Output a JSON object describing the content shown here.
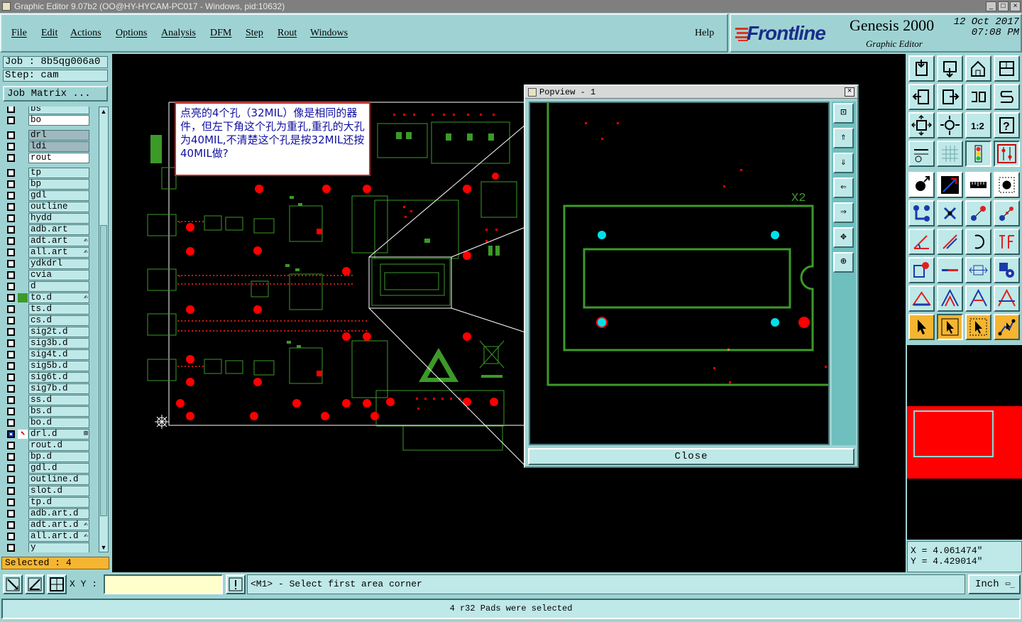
{
  "window": {
    "title": "Graphic Editor 9.07b2 (OO@HY-HYCAM-PC017 - Windows, pid:10632)",
    "controls": [
      "_",
      "□",
      "×"
    ]
  },
  "menu": {
    "items": [
      "File",
      "Edit",
      "Actions",
      "Options",
      "Analysis",
      "DFM",
      "Step",
      "Rout",
      "Windows"
    ],
    "help": "Help"
  },
  "brand": {
    "logo": "Frontline",
    "product": "Genesis 2000",
    "subtitle": "Graphic Editor",
    "date": "12 Oct 2017",
    "time": "07:08 PM"
  },
  "job": {
    "job_label": "Job : 8b5qg006a0",
    "step_label": "Step: cam",
    "matrix_button": "Job Matrix ..."
  },
  "layers": [
    {
      "name": "bs",
      "style": "normal"
    },
    {
      "name": "bo",
      "style": "white"
    },
    {
      "name": "drl",
      "style": "grey",
      "group_gap": true
    },
    {
      "name": "ldi",
      "style": "grey"
    },
    {
      "name": "rout",
      "style": "white"
    },
    {
      "name": "tp",
      "style": "normal",
      "group_gap": true
    },
    {
      "name": "bp",
      "style": "normal"
    },
    {
      "name": "gdl",
      "style": "normal"
    },
    {
      "name": "outline",
      "style": "normal"
    },
    {
      "name": "hydd",
      "style": "normal"
    },
    {
      "name": "adb.art",
      "style": "normal"
    },
    {
      "name": "adt.art",
      "style": "normal",
      "pen": "✍"
    },
    {
      "name": "all.art",
      "style": "normal",
      "pen": "✍"
    },
    {
      "name": "ydkdrl",
      "style": "normal"
    },
    {
      "name": "cvia",
      "style": "normal"
    },
    {
      "name": "d",
      "style": "normal"
    },
    {
      "name": "to.d",
      "style": "normal",
      "mark": "green",
      "pen": "✍"
    },
    {
      "name": "ts.d",
      "style": "normal"
    },
    {
      "name": "cs.d",
      "style": "normal"
    },
    {
      "name": "sig2t.d",
      "style": "normal"
    },
    {
      "name": "sig3b.d",
      "style": "normal"
    },
    {
      "name": "sig4t.d",
      "style": "normal"
    },
    {
      "name": "sig5b.d",
      "style": "normal"
    },
    {
      "name": "sig6t.d",
      "style": "normal"
    },
    {
      "name": "sig7b.d",
      "style": "normal"
    },
    {
      "name": "ss.d",
      "style": "normal"
    },
    {
      "name": "bs.d",
      "style": "normal"
    },
    {
      "name": "bo.d",
      "style": "normal"
    },
    {
      "name": "drl.d",
      "style": "normal",
      "mark": "red",
      "work": true,
      "pen": "⊞"
    },
    {
      "name": "rout.d",
      "style": "normal"
    },
    {
      "name": "bp.d",
      "style": "normal"
    },
    {
      "name": "gdl.d",
      "style": "normal"
    },
    {
      "name": "outline.d",
      "style": "normal"
    },
    {
      "name": "slot.d",
      "style": "normal"
    },
    {
      "name": "tp.d",
      "style": "normal"
    },
    {
      "name": "adb.art.d",
      "style": "normal"
    },
    {
      "name": "adt.art.d",
      "style": "normal",
      "pen": "✍"
    },
    {
      "name": "all.art.d",
      "style": "normal",
      "pen": "✍"
    },
    {
      "name": "y",
      "style": "normal"
    }
  ],
  "selected_count": "Selected : 4",
  "note": {
    "text": "点亮的4个孔（32MIL）像是相同的器件，但左下角这个孔为重孔,重孔的大孔为40MIL,不清楚这个孔是按32MIL还按40MIL做?"
  },
  "popview": {
    "title": "Popview - 1",
    "close_label": "Close",
    "component_label": "X2"
  },
  "coords": {
    "x": "X = 4.061474\"",
    "y": "Y = 4.429014\""
  },
  "bottom": {
    "xy_label": "X Y :",
    "xy_value": "",
    "prompt": "<M1> - Select first area corner",
    "unit": "Inch",
    "status": "4 r32 Pads were selected"
  },
  "colors": {
    "panel": "#9fd3d3",
    "field": "#bfe8e8",
    "pcb_green": "#3c9a28",
    "pad_red": "#ff0000",
    "selected_pad": "#00e0e8",
    "highlight_orange": "#f5b530"
  }
}
